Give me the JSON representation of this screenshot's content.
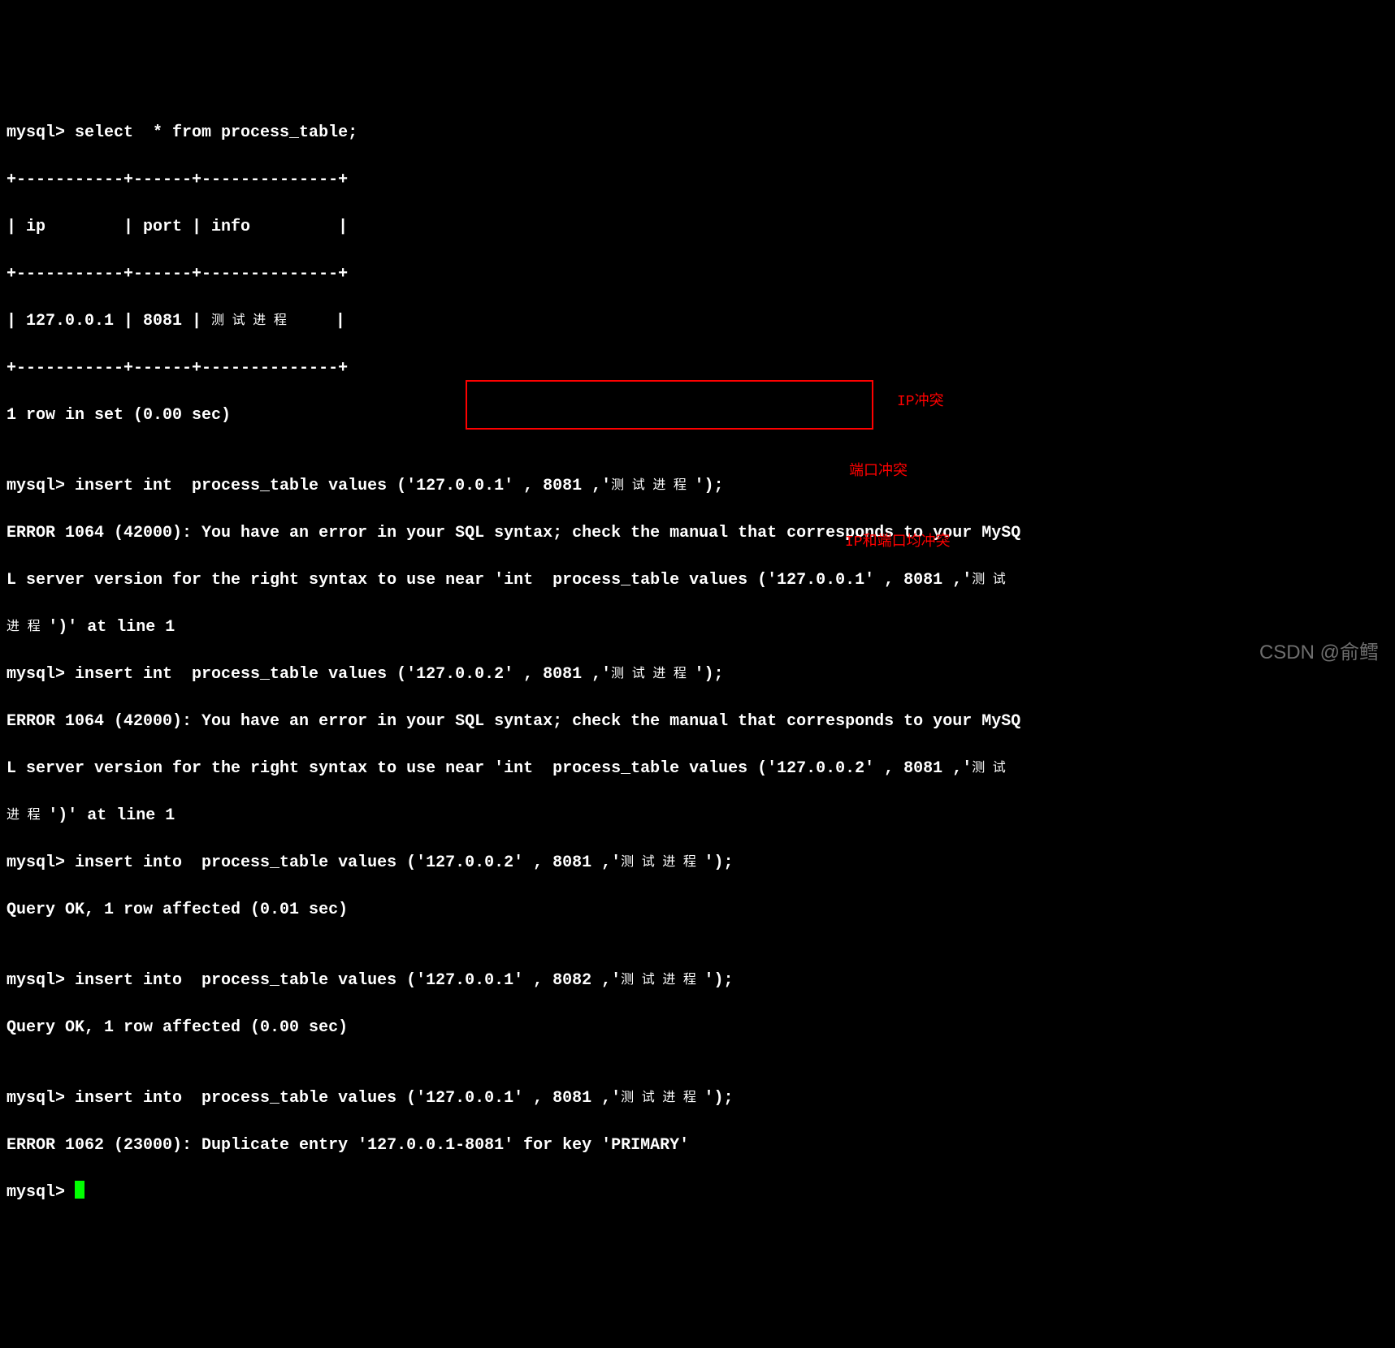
{
  "terminal": {
    "lines": {
      "l01": "mysql> select  * from process_table;",
      "l02": "+-----------+------+--------------+",
      "l03": "| ip        | port | info         |",
      "l04": "+-----------+------+--------------+",
      "l05a": "| 127.0.0.1 | 8081 | ",
      "l05cjk": "测 试 进 程",
      "l05b": "     |",
      "l06": "+-----------+------+--------------+",
      "l07": "1 row in set (0.00 sec)",
      "l08": "",
      "l09a": "mysql> insert int  process_table values ('127.0.0.1' , 8081 ,'",
      "l09cjk": "测 试 进 程 ",
      "l09b": "');",
      "l10": "ERROR 1064 (42000): You have an error in your SQL syntax; check the manual that corresponds to your MySQ",
      "l11a": "L server version for the right syntax to use near 'int  process_table values ('127.0.0.1' , 8081 ,'",
      "l11cjk": "测 试 ",
      "l12cjk": "进 程 ",
      "l12b": "')' at line 1",
      "l13a": "mysql> insert int  process_table values ('127.0.0.2' , 8081 ,'",
      "l13cjk": "测 试 进 程 ",
      "l13b": "');",
      "l14": "ERROR 1064 (42000): You have an error in your SQL syntax; check the manual that corresponds to your MySQ",
      "l15a": "L server version for the right syntax to use near 'int  process_table values ('127.0.0.2' , 8081 ,'",
      "l15cjk": "测 试 ",
      "l16cjk": "进 程 ",
      "l16b": "')' at line 1",
      "l17a": "mysql> insert into  process_table values ('127.0.0.2' , 8081 ,'",
      "l17cjk": "测 试 进 程 ",
      "l17b": "');",
      "l18": "Query OK, 1 row affected (0.01 sec)",
      "l19": "",
      "l20a": "mysql> insert into  process_table values ('127.0.0.1' , 8082 ,'",
      "l20cjk": "测 试 进 程 ",
      "l20b": "');",
      "l21": "Query OK, 1 row affected (0.00 sec)",
      "l22": "",
      "l23a": "mysql> insert into  process_table values ('127.0.0.1' , 8081 ,'",
      "l23cjk": "测 试 进 程 ",
      "l23b": "');",
      "l24": "ERROR 1062 (23000): Duplicate entry '127.0.0.1-8081' for key 'PRIMARY'",
      "l25": "mysql> "
    }
  },
  "annotations": {
    "a1": "IP冲突",
    "a2": "端口冲突",
    "a3": "IP和端口均冲突"
  },
  "watermark": "CSDN @俞鳕"
}
